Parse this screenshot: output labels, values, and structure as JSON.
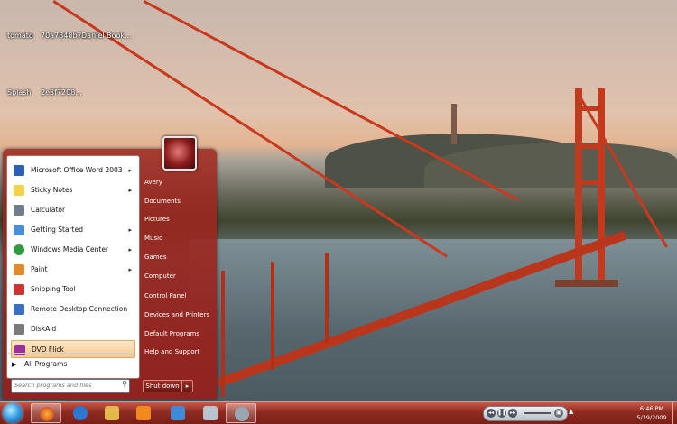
{
  "desktop": {
    "icons": [
      {
        "label": "tomato"
      },
      {
        "label": "70a7848b7..."
      },
      {
        "label": "Daniel Book..."
      },
      {
        "label": "Splash"
      },
      {
        "label": "2e3f7208..."
      }
    ]
  },
  "start_menu": {
    "programs": [
      {
        "label": "Microsoft Office Word 2003",
        "has_submenu": true,
        "color": "#2b5fb8"
      },
      {
        "label": "Sticky Notes",
        "has_submenu": true,
        "color": "#f2d24a"
      },
      {
        "label": "Calculator",
        "has_submenu": false,
        "color": "#6f7d8c"
      },
      {
        "label": "Getting Started",
        "has_submenu": true,
        "color": "#4a8ed6"
      },
      {
        "label": "Windows Media Center",
        "has_submenu": true,
        "color": "#2f9a3e"
      },
      {
        "label": "Paint",
        "has_submenu": true,
        "color": "#e08a2b"
      },
      {
        "label": "Snipping Tool",
        "has_submenu": false,
        "color": "#cc3333"
      },
      {
        "label": "Remote Desktop Connection",
        "has_submenu": false,
        "color": "#3a6fc2"
      },
      {
        "label": "DiskAid",
        "has_submenu": false,
        "color": "#7a7a7a"
      },
      {
        "label": "DVD Flick",
        "has_submenu": false,
        "color": "#9c2f9c",
        "highlighted": true
      }
    ],
    "all_programs": "All Programs",
    "search_placeholder": "Search programs and files",
    "right_items": [
      {
        "label": "Avery"
      },
      {
        "label": "Documents"
      },
      {
        "label": "Pictures"
      },
      {
        "label": "Music"
      },
      {
        "label": "Games"
      },
      {
        "label": "Computer"
      },
      {
        "label": "Control Panel"
      },
      {
        "label": "Devices and Printers"
      },
      {
        "label": "Default Programs"
      },
      {
        "label": "Help and Support"
      }
    ],
    "shutdown_label": "Shut down",
    "shutdown_arrow": "▸"
  },
  "taskbar": {
    "buttons": [
      {
        "name": "firefox",
        "active": true,
        "color": "#e2651c"
      },
      {
        "name": "internet-explorer",
        "active": false,
        "color": "#2a78d2"
      },
      {
        "name": "explorer-folder",
        "active": false,
        "color": "#e3b84a"
      },
      {
        "name": "media-player",
        "active": false,
        "color": "#f08a1e"
      },
      {
        "name": "windows-update",
        "active": false,
        "color": "#3d8ad6"
      },
      {
        "name": "recycle-bin",
        "active": false,
        "color": "#b8c4cf"
      },
      {
        "name": "system-restore",
        "active": true,
        "color": "#9aa7b3"
      }
    ],
    "clock_time": "6:46 PM",
    "clock_date": "5/19/2009",
    "tray_arrow": "▲"
  }
}
